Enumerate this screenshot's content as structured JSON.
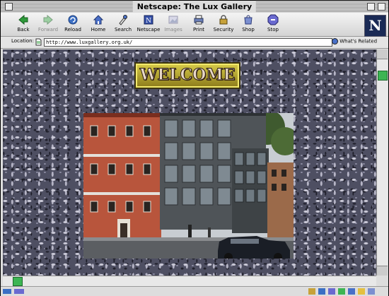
{
  "window": {
    "title": "Netscape: The Lux Gallery"
  },
  "toolbar": {
    "buttons": [
      {
        "label": "Back",
        "icon": "back-arrow-icon"
      },
      {
        "label": "Forward",
        "icon": "forward-arrow-icon",
        "disabled": true
      },
      {
        "label": "Reload",
        "icon": "reload-icon"
      },
      {
        "label": "Home",
        "icon": "home-icon"
      },
      {
        "label": "Search",
        "icon": "search-icon"
      },
      {
        "label": "Netscape",
        "icon": "netscape-icon"
      },
      {
        "label": "Images",
        "icon": "images-icon",
        "disabled": true
      },
      {
        "label": "Print",
        "icon": "print-icon"
      },
      {
        "label": "Security",
        "icon": "lock-icon"
      },
      {
        "label": "Shop",
        "icon": "shop-icon"
      },
      {
        "label": "Stop",
        "icon": "stop-icon"
      }
    ],
    "logo": "N"
  },
  "location": {
    "label": "Location:",
    "url": "http://www.luxgallery.org.uk/",
    "related_label": "What's Related"
  },
  "page": {
    "welcome_text": "WELCOME"
  },
  "colors": {
    "scroll_thumb": "#3db553",
    "background_pattern": "#4e4f62"
  }
}
